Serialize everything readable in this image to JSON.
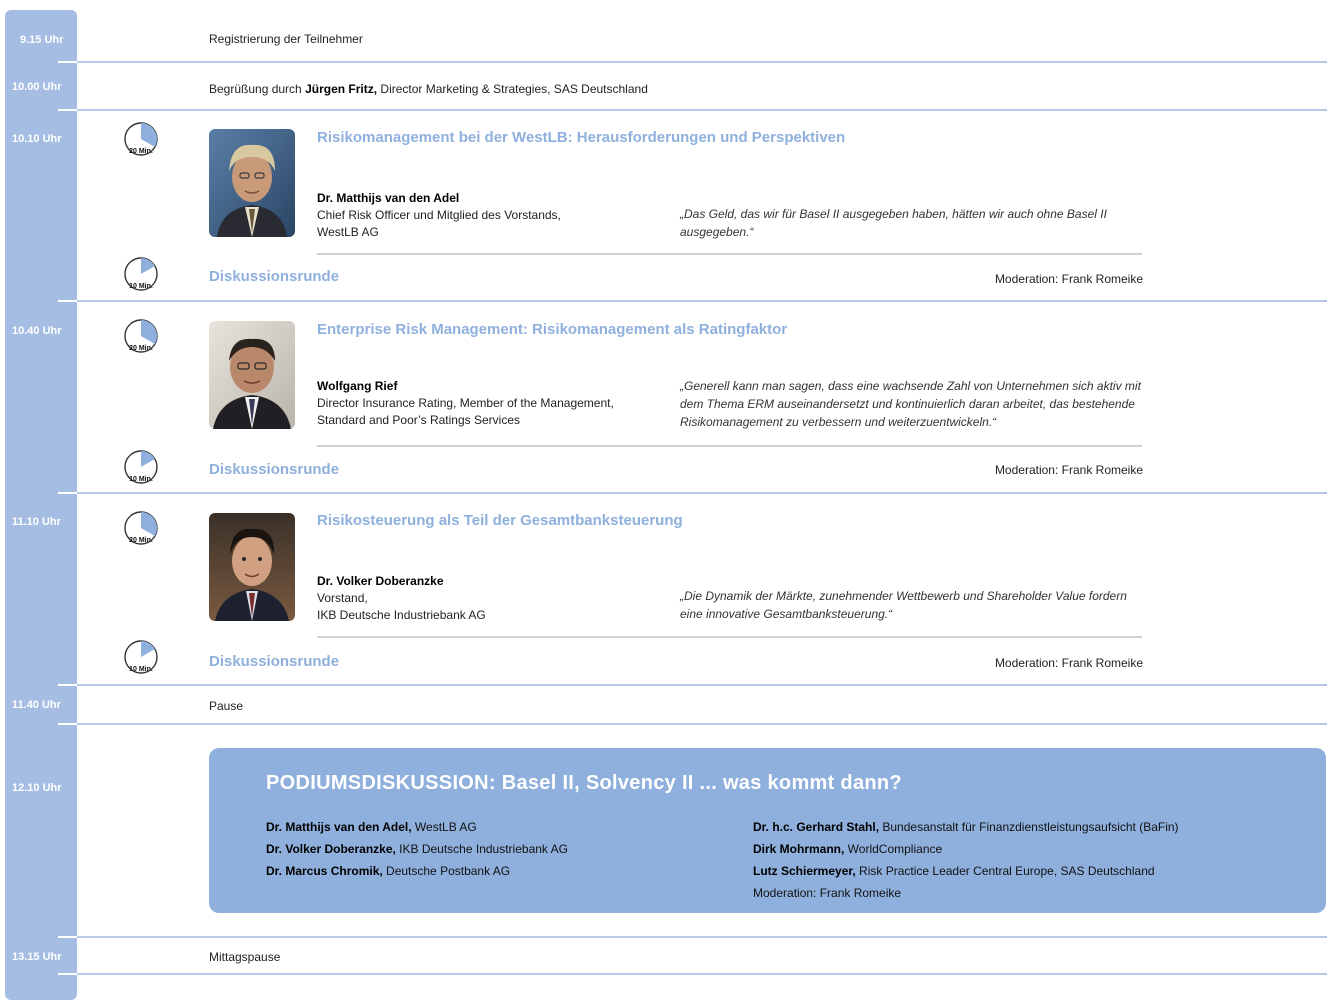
{
  "schedule": {
    "t0915": {
      "time": "9.15 Uhr",
      "text": "Registrierung der Teilnehmer"
    },
    "t1000": {
      "time": "10.00 Uhr",
      "prefix": "Begrüßung durch ",
      "name": "Jürgen Fritz,",
      "suffix": " Director Marketing & Strategies, SAS Deutschland"
    },
    "t1010": {
      "time": "10.10 Uhr"
    },
    "t1040": {
      "time": "10.40 Uhr"
    },
    "t1110": {
      "time": "11.10 Uhr"
    },
    "t1140": {
      "time": "11.40 Uhr",
      "text": "Pause"
    },
    "t1210": {
      "time": "12.10 Uhr"
    },
    "t1315": {
      "time": "13.15 Uhr",
      "text": "Mittagspause"
    }
  },
  "clocks": {
    "talk_label": "20 Min.",
    "talk_minutes": 20,
    "disc_label": "10 Min.",
    "disc_minutes": 10
  },
  "talks": [
    {
      "title": "Risikomanagement bei der WestLB: Herausforderungen und Perspektiven",
      "speaker": "Dr. Matthijs van den Adel",
      "role_line1": "Chief Risk Officer und Mitglied des Vorstands,",
      "role_line2": "WestLB AG",
      "quote": "„Das Geld, das wir für Basel II ausgegeben haben, hätten wir auch ohne Basel II ausgegeben.“",
      "discussion": "Diskussionsrunde",
      "moderation": "Moderation: Frank Romeike"
    },
    {
      "title": "Enterprise Risk Management: Risikomanagement als Ratingfaktor",
      "speaker": "Wolfgang Rief",
      "role_line1": "Director Insurance Rating, Member of the Management,",
      "role_line2": "Standard and Poor’s Ratings Services",
      "quote": "„Generell kann man sagen, dass eine wachsende Zahl von Unternehmen sich aktiv mit dem Thema ERM auseinandersetzt und kontinuierlich daran arbeitet, das bestehende Risikomanagement zu verbessern und weiterzuentwickeln.“",
      "discussion": "Diskussionsrunde",
      "moderation": "Moderation: Frank Romeike"
    },
    {
      "title": "Risikosteuerung als Teil der Gesamtbanksteuerung",
      "speaker": "Dr. Volker Doberanzke",
      "role_line1": "Vorstand,",
      "role_line2": "IKB Deutsche Industriebank AG",
      "quote": "„Die Dynamik der Märkte, zunehmender Wettbewerb und Shareholder Value fordern eine innovative Gesamtbanksteuerung.“",
      "discussion": "Diskussionsrunde",
      "moderation": "Moderation: Frank Romeike"
    }
  ],
  "podium": {
    "title": "PODIUMSDISKUSSION:  Basel II, Solvency II ... was kommt dann?",
    "left": [
      {
        "name": "Dr. Matthijs van den Adel,",
        "org": " WestLB AG"
      },
      {
        "name": "Dr. Volker Doberanzke,",
        "org": " IKB Deutsche Industriebank AG"
      },
      {
        "name": "Dr. Marcus Chromik,",
        "org": " Deutsche Postbank AG"
      }
    ],
    "right": [
      {
        "name": "Dr. h.c. Gerhard Stahl,",
        "org": " Bundesanstalt für Finanzdienstleistungsaufsicht (BaFin)"
      },
      {
        "name": "Dirk Mohrmann,",
        "org": " WorldCompliance"
      },
      {
        "name": "Lutz Schiermeyer,",
        "org": " Risk Practice Leader Central Europe, SAS Deutschland"
      }
    ],
    "moderation": "Moderation: Frank Romeike"
  }
}
